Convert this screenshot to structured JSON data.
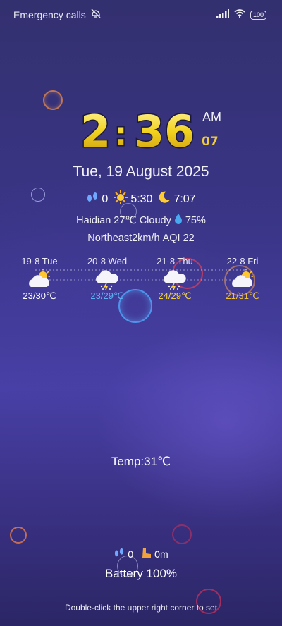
{
  "status_bar": {
    "left_text": "Emergency calls",
    "battery": "100"
  },
  "clock": {
    "hours": "2",
    "colon": ":",
    "minutes": "36",
    "ampm": "AM",
    "seconds": "07"
  },
  "date": "Tue, 19 August 2025",
  "astro": {
    "steps": "0",
    "sunrise": "5:30",
    "sunset": "7:07"
  },
  "weather": {
    "line1_location": "Haidian",
    "line1_temp": "27℃",
    "line1_condition": "Cloudy",
    "line1_humidity": "75%",
    "line2_wind": "Northeast",
    "line2_speed": "2km/h",
    "line2_aqi": "AQI 22"
  },
  "forecast": [
    {
      "date": "19-8 Tue",
      "icon": "partly-cloudy-sun-icon",
      "temp": "23/30℃",
      "color": "#ffffff"
    },
    {
      "date": "20-8 Wed",
      "icon": "thunderstorm-icon",
      "temp": "23/29℃",
      "color": "#5fb1f5"
    },
    {
      "date": "21-8 Thu",
      "icon": "thunderstorm-icon",
      "temp": "24/29℃",
      "color": "#f2d33a"
    },
    {
      "date": "22-8 Fri",
      "icon": "partly-cloudy-sun-icon",
      "temp": "21/31℃",
      "color": "#f1c234"
    }
  ],
  "current_temp": "Temp:31℃",
  "footer": {
    "steps": "0",
    "distance": "0m",
    "battery": "Battery 100%",
    "hint": "Double-click the upper right corner to set"
  }
}
